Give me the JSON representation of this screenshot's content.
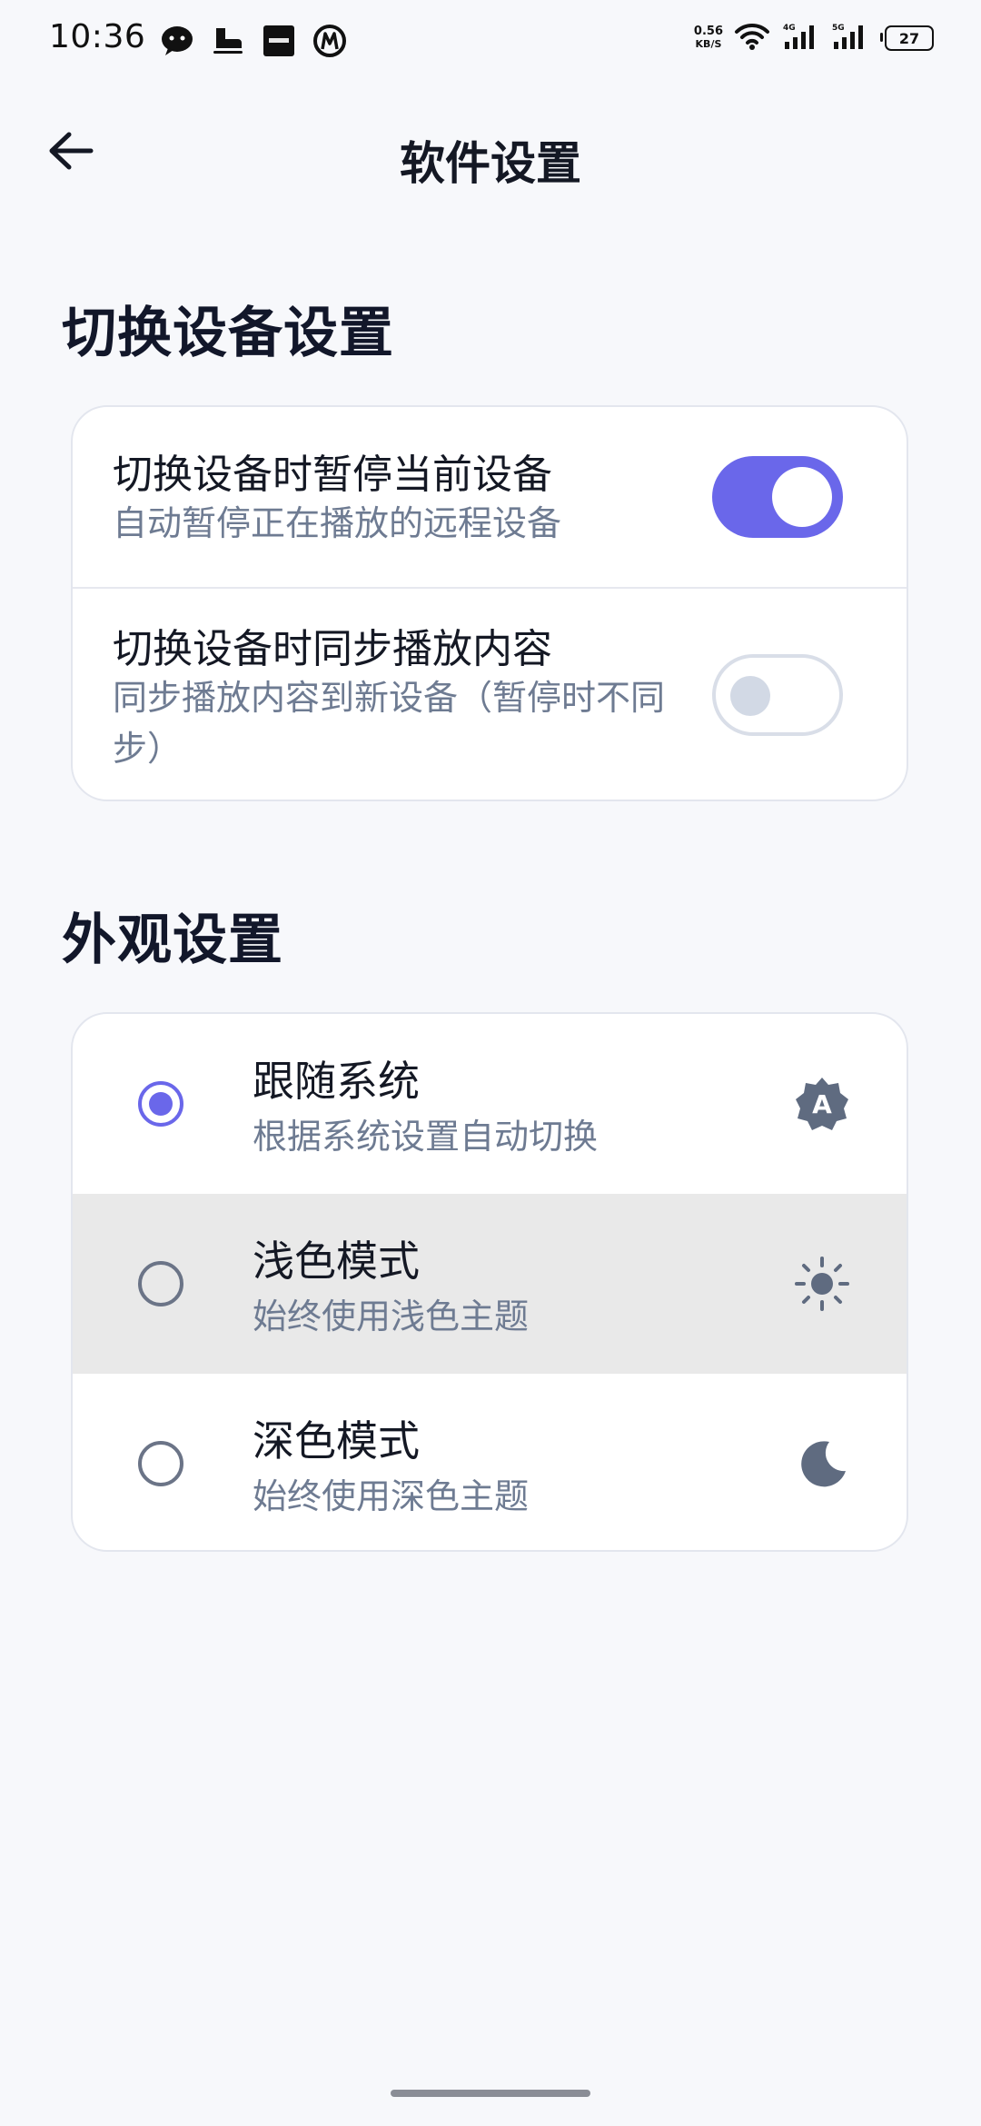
{
  "status_bar": {
    "time": "10:36",
    "net_speed": "0.56",
    "net_unit": "KB/S",
    "battery": "27",
    "app_icons": [
      "wechat-icon",
      "skate-icon",
      "xiaohongshu-icon",
      "metro-icon"
    ],
    "system_icons": [
      "wifi-icon",
      "signal-4g-icon",
      "signal-5g-icon"
    ]
  },
  "header": {
    "title": "软件设置",
    "back_icon": "arrow-left-icon"
  },
  "device_section": {
    "title": "切换设备设置",
    "items": [
      {
        "title": "切换设备时暂停当前设备",
        "desc": "自动暂停正在播放的远程设备",
        "enabled": true
      },
      {
        "title": "切换设备时同步播放内容",
        "desc": "同步播放内容到新设备（暂停时不同步）",
        "enabled": false
      }
    ]
  },
  "appearance_section": {
    "title": "外观设置",
    "options": [
      {
        "title": "跟随系统",
        "desc": "根据系统设置自动切换",
        "selected": true,
        "icon": "auto-theme-icon"
      },
      {
        "title": "浅色模式",
        "desc": "始终使用浅色主题",
        "selected": false,
        "icon": "sun-icon"
      },
      {
        "title": "深色模式",
        "desc": "始终使用深色主题",
        "selected": false,
        "icon": "moon-icon"
      }
    ]
  },
  "colors": {
    "accent": "#6a67ea",
    "background": "#f7f8fb",
    "card": "#ffffff",
    "secondary_text": "#6e7b92",
    "highlight_row": "#e9e9e9"
  }
}
